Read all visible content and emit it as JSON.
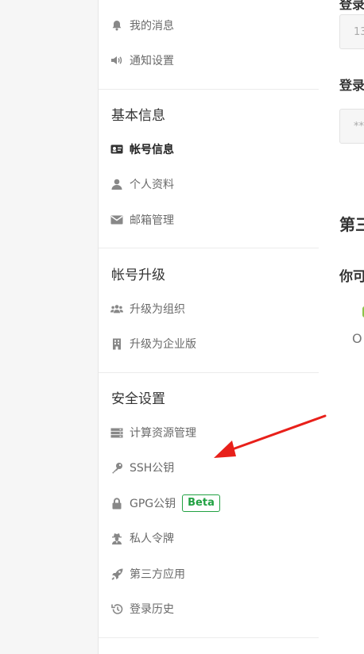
{
  "sidebar": {
    "top_items": [
      {
        "label": "我的消息",
        "icon": "bell-icon"
      },
      {
        "label": "通知设置",
        "icon": "volume-icon"
      }
    ],
    "sections": [
      {
        "title": "基本信息",
        "items": [
          {
            "label": "帐号信息",
            "icon": "id-card-icon",
            "active": true
          },
          {
            "label": "个人资料",
            "icon": "user-icon"
          },
          {
            "label": "邮箱管理",
            "icon": "envelope-icon"
          }
        ]
      },
      {
        "title": "帐号升级",
        "items": [
          {
            "label": "升级为组织",
            "icon": "users-icon"
          },
          {
            "label": "升级为企业版",
            "icon": "building-icon"
          }
        ]
      },
      {
        "title": "安全设置",
        "items": [
          {
            "label": "计算资源管理",
            "icon": "server-icon"
          },
          {
            "label": "SSH公钥",
            "icon": "key-icon"
          },
          {
            "label": "GPG公钥",
            "icon": "lock-icon",
            "badge": "Beta"
          },
          {
            "label": "私人令牌",
            "icon": "user-secret-icon"
          },
          {
            "label": "第三方应用",
            "icon": "rocket-icon"
          },
          {
            "label": "登录历史",
            "icon": "history-icon"
          }
        ]
      }
    ]
  },
  "main": {
    "label_top": "登录",
    "input1_value": "13",
    "label2": "登录",
    "input2_value": "**",
    "heading": "第三",
    "subheading": "你可",
    "text": "O"
  },
  "colors": {
    "badge": "#21a142",
    "arrow": "#e8201a",
    "icon": "#888888"
  }
}
